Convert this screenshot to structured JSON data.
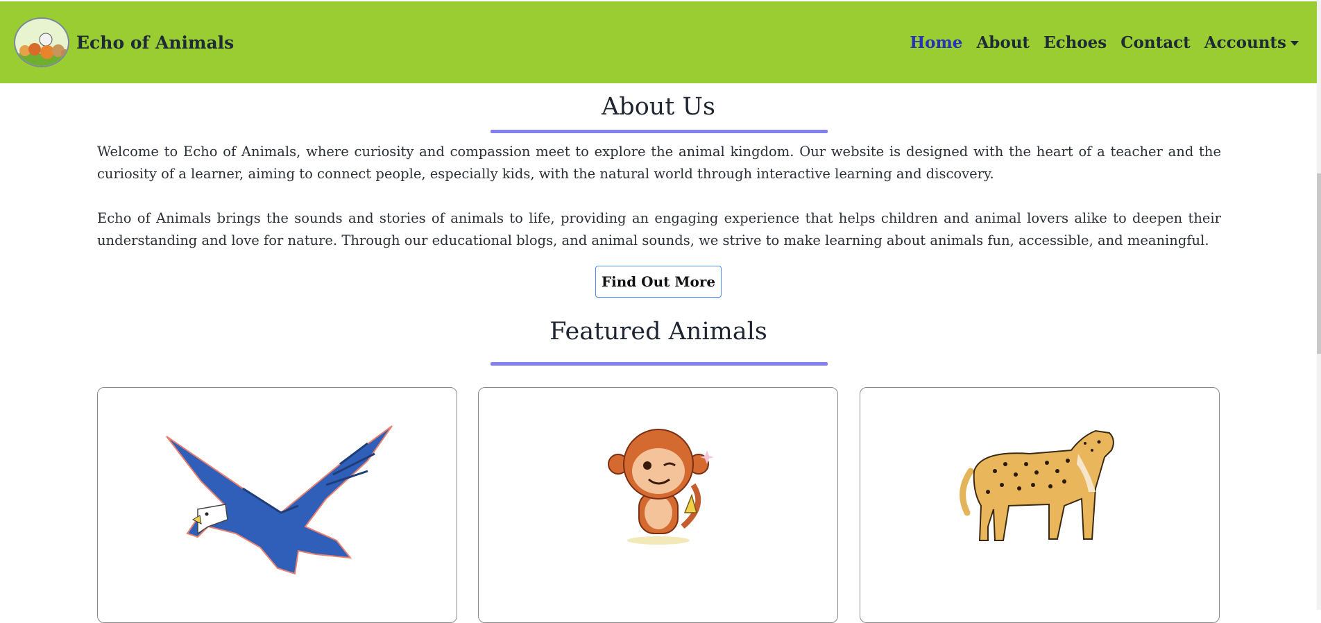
{
  "navbar": {
    "brand": "Echo of Animals",
    "links": [
      "Home",
      "About",
      "Echoes",
      "Contact",
      "Accounts"
    ],
    "active_color": "#2534b8",
    "bg_color": "#9acd32"
  },
  "about": {
    "title": "About Us",
    "paragraphs": [
      "Welcome to Echo of Animals, where curiosity and compassion meet to explore the animal kingdom. Our website is designed with the heart of a teacher and the curiosity of a learner, aiming to connect people, especially kids, with the natural world through interactive learning and discovery.",
      "Echo of Animals brings the sounds and stories of animals to life, providing an engaging experience that helps children and animal lovers alike to deepen their understanding and love for nature. Through our educational blogs, and animal sounds, we strive to make learning about animals fun, accessible, and meaningful."
    ],
    "button": "Find Out More"
  },
  "featured": {
    "title": "Featured Animals",
    "cards": [
      "eagle-image",
      "monkey-image",
      "cheetah-image"
    ],
    "accent_color": "#8080f0"
  }
}
